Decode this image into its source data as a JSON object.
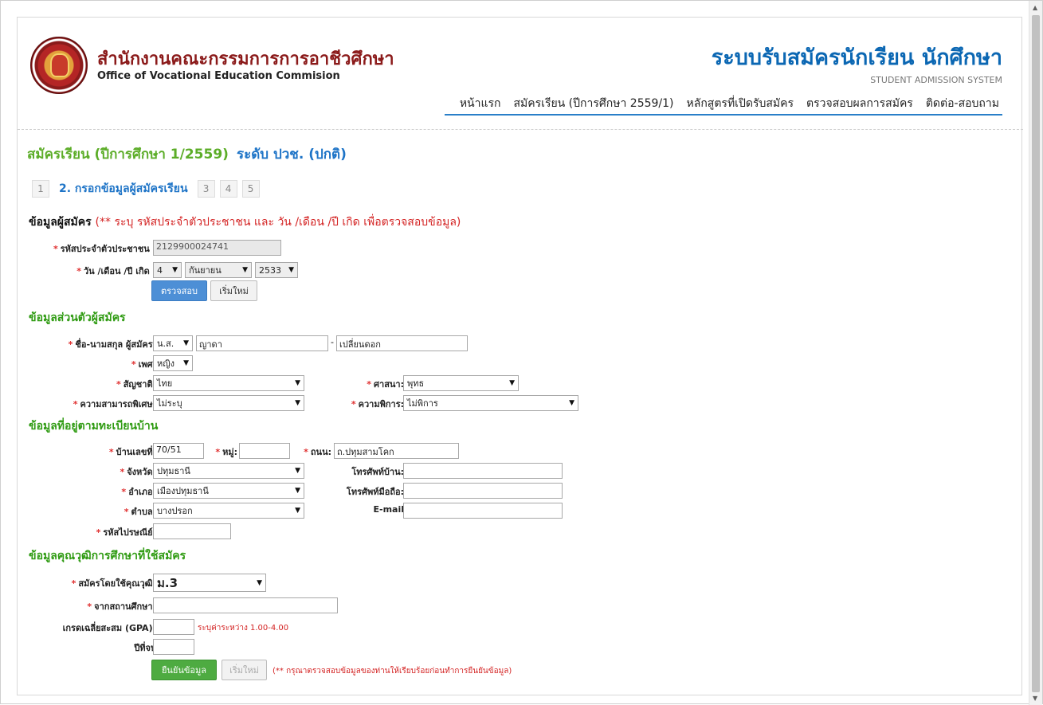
{
  "header": {
    "org_th": "สำนักงานคณะกรรมการการอาชีวศึกษา",
    "org_en": "Office of Vocational Education Commision",
    "system_th": "ระบบรับสมัครนักเรียน นักศึกษา",
    "system_en": "STUDENT ADMISSION SYSTEM",
    "nav": [
      "หน้าแรก",
      "สมัครเรียน (ปีการศึกษา 2559/1)",
      "หลักสูตรที่เปิดรับสมัคร",
      "ตรวจสอบผลการสมัคร",
      "ติดต่อ-สอบถาม"
    ]
  },
  "title": {
    "main": "สมัครเรียน (ปีการศึกษา 1/2559)",
    "level": "ระดับ ปวช. (ปกติ)"
  },
  "steps": {
    "s1": "1",
    "active": "2. กรอกข้อมูลผู้สมัครเรียน",
    "s3": "3",
    "s4": "4",
    "s5": "5"
  },
  "applicant": {
    "heading": "ข้อมูลผู้สมัคร",
    "note": "(** ระบุ รหัสประจำตัวประชาชน และ วัน /เดือน /ปี เกิด เพื่อตรวจสอบข้อมูล)",
    "id_label": "รหัสประจำตัวประชาชน :",
    "id_value": "2129900024741",
    "dob_label": "วัน /เดือน /ปี เกิด :",
    "day": "4",
    "month": "กันยายน",
    "year": "2533",
    "check_btn": "ตรวจสอบ",
    "reset_btn": "เริ่มใหม่"
  },
  "personal": {
    "heading": "ข้อมูลส่วนตัวผู้สมัคร",
    "name_label": "ชื่อ-นามสกุล ผู้สมัคร:",
    "prefix": "น.ส.",
    "first_name": "ญาดา",
    "dash": "-",
    "last_name": "เปลี่ยนดอก",
    "sex_label": "เพศ:",
    "sex": "หญิง",
    "nationality_label": "สัญชาติ:",
    "nationality": "ไทย",
    "religion_label": "ศาสนา:",
    "religion": "พุทธ",
    "ability_label": "ความสามารถพิเศษ:",
    "ability": "ไม่ระบุ",
    "disability_label": "ความพิการ:",
    "disability": "ไม่พิการ"
  },
  "address": {
    "heading": "ข้อมูลที่อยู่ตามทะเบียนบ้าน",
    "house_label": "บ้านเลขที่:",
    "house": "70/51",
    "moo_label": "หมู่:",
    "moo": "",
    "road_label": "ถนน:",
    "road": "ถ.ปทุมสามโคก",
    "province_label": "จังหวัด:",
    "province": "ปทุมธานี",
    "home_phone_label": "โทรศัพท์บ้าน:",
    "home_phone": "",
    "district_label": "อำเภอ:",
    "district": "เมืองปทุมธานี",
    "mobile_label": "โทรศัพท์มือถือ:",
    "mobile": "",
    "subdistrict_label": "ตำบล:",
    "subdistrict": "บางปรอก",
    "email_label": "E-mail",
    "email": "",
    "zip_label": "รหัสไปรษณีย์:",
    "zip": ""
  },
  "education": {
    "heading": "ข้อมูลคุณวุฒิการศึกษาที่ใช้สมัคร",
    "qual_label": "สมัครโดยใช้คุณวุฒิ:",
    "qual": "ม.3",
    "school_label": "จากสถานศึกษา:",
    "school": "",
    "gpa_label": "เกรดเฉลี่ยสะสม (GPA):",
    "gpa": "",
    "gpa_hint": "ระบุค่าระหว่าง 1.00-4.00",
    "grad_year_label": "ปีที่จบ",
    "grad_year": "",
    "confirm_btn": "ยืนยันข้อมูล",
    "reset_btn": "เริ่มใหม่",
    "footer_note": "(** กรุณาตรวจสอบข้อมูลของท่านให้เรียบร้อยก่อนทำการยืนยันข้อมูล)"
  }
}
